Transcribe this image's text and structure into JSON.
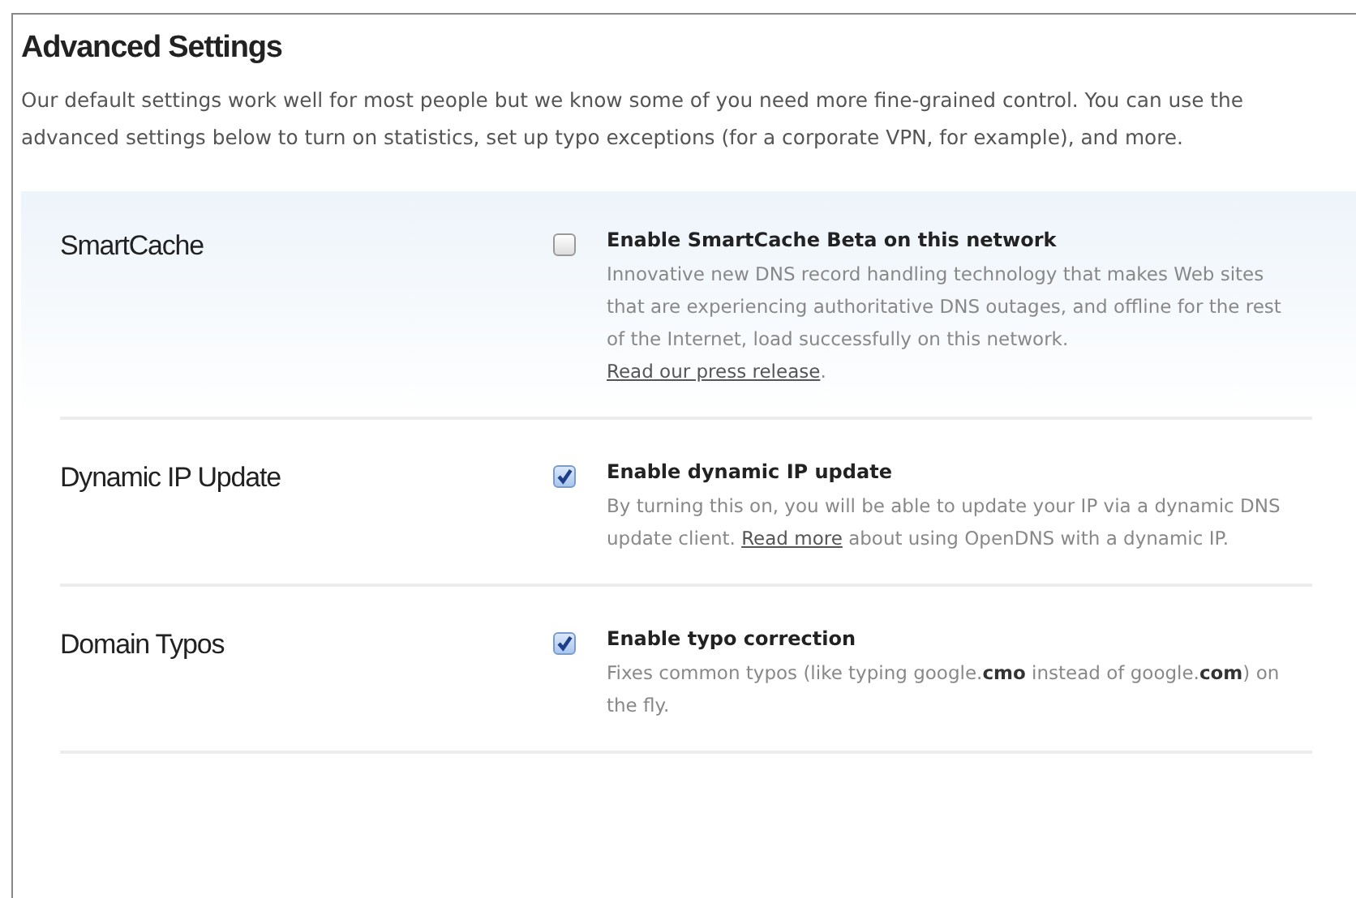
{
  "title": "Advanced Settings",
  "intro": "Our default settings work well for most people but we know some of you need more fine-grained control. You can use the advanced settings below to turn on statistics, set up typo exceptions (for a corporate VPN, for example), and more.",
  "settings": [
    {
      "name": "SmartCache",
      "option": "Enable SmartCache Beta on this network",
      "checked": false,
      "description": [
        {
          "kind": "text",
          "text": "Innovative new DNS record handling technology that makes Web sites that are experiencing authoritative DNS outages, and offline for the rest of the Internet, load successfully on this network. "
        },
        {
          "kind": "link",
          "text": "Read our press release"
        },
        {
          "kind": "text",
          "text": "."
        }
      ]
    },
    {
      "name": "Dynamic IP Update",
      "option": "Enable dynamic IP update",
      "checked": true,
      "description": [
        {
          "kind": "text",
          "text": "By turning this on, you will be able to update your IP via a dynamic DNS update client. "
        },
        {
          "kind": "link",
          "text": "Read more"
        },
        {
          "kind": "text",
          "text": " about using OpenDNS with a dynamic IP."
        }
      ]
    },
    {
      "name": "Domain Typos",
      "option": "Enable typo correction",
      "checked": true,
      "description": [
        {
          "kind": "text",
          "text": "Fixes common typos (like typing google.**cmo** instead of google.**com**) on the fly."
        }
      ]
    }
  ]
}
